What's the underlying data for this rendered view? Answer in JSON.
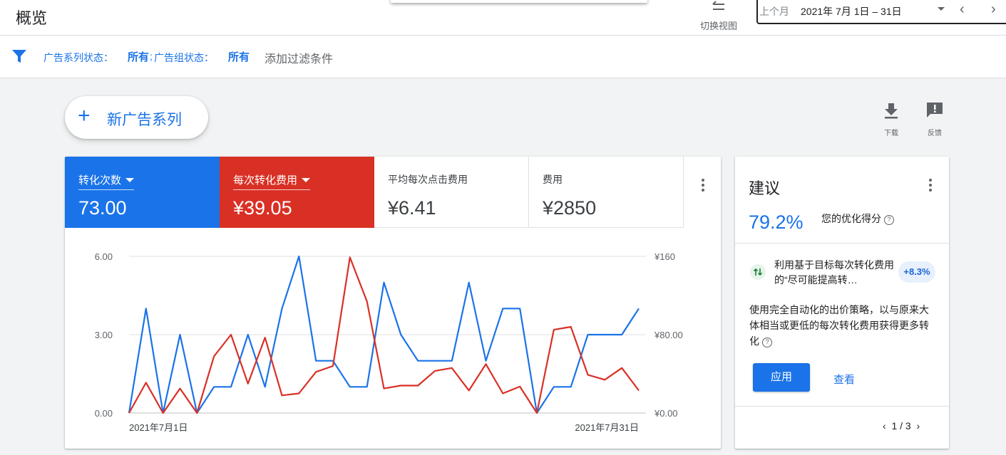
{
  "header": {
    "title": "概览",
    "switch_view_label": "切换视图"
  },
  "date_range": {
    "preset": "上个月",
    "range": "2021年 7月 1日 – 31日",
    "prev_icon": "chevron-left-icon",
    "next_icon": "chevron-right-icon"
  },
  "filters": {
    "campaign_status_key": "广告系列状态：",
    "campaign_status_value": "所有",
    "separator": ";",
    "adgroup_status_key": "广告组状态：",
    "adgroup_status_value": "所有",
    "add_filter": "添加过滤条件"
  },
  "toolbar": {
    "new_campaign": "新广告系列",
    "download": "下载",
    "feedback": "反馈"
  },
  "metrics": [
    {
      "name": "转化次数",
      "value": "73.00",
      "selected": true,
      "color": "#1a73e8"
    },
    {
      "name": "每次转化费用",
      "value": "¥39.05",
      "selected": true,
      "color": "#d93025"
    },
    {
      "name": "平均每次点击费用",
      "value": "¥6.41",
      "selected": false
    },
    {
      "name": "费用",
      "value": "¥2850",
      "selected": false
    }
  ],
  "chart_data": {
    "type": "line",
    "x_start_label": "2021年7月1日",
    "x_end_label": "2021年7月31日",
    "left_axis": {
      "ticks": [
        "0.00",
        "3.00",
        "6.00"
      ],
      "ylim": [
        0,
        6
      ]
    },
    "right_axis": {
      "ticks": [
        "¥0.00",
        "¥80.00",
        "¥160"
      ],
      "ylim": [
        0,
        160
      ]
    },
    "series": [
      {
        "name": "转化次数",
        "axis": "left",
        "color": "#1a73e8",
        "values": [
          0,
          4,
          0,
          3,
          0,
          1,
          1,
          3,
          1,
          4,
          6,
          2,
          2,
          1,
          1,
          5,
          3,
          2,
          2,
          2,
          5,
          2,
          4,
          4,
          0,
          1,
          1,
          3,
          3,
          3,
          4
        ]
      },
      {
        "name": "每次转化费用",
        "axis": "right",
        "color": "#d93025",
        "values": [
          0,
          31,
          0,
          25,
          0,
          58,
          80,
          30,
          77,
          18,
          20,
          42,
          48,
          159,
          114,
          25,
          28,
          28,
          43,
          46,
          23,
          50,
          20,
          27,
          0,
          85,
          88,
          39,
          34,
          46,
          23
        ]
      }
    ]
  },
  "suggestion": {
    "title": "建议",
    "score": "79.2%",
    "score_label": "您的优化得分",
    "rec_title": "利用基于目标每次转化费用的“尽可能提高转…",
    "rec_badge": "+8.3%",
    "description": "使用完全自动化的出价策略，以与原来大体相当或更低的每次转化费用获得更多转化",
    "apply": "应用",
    "view": "查看",
    "pager": "1 / 3"
  }
}
